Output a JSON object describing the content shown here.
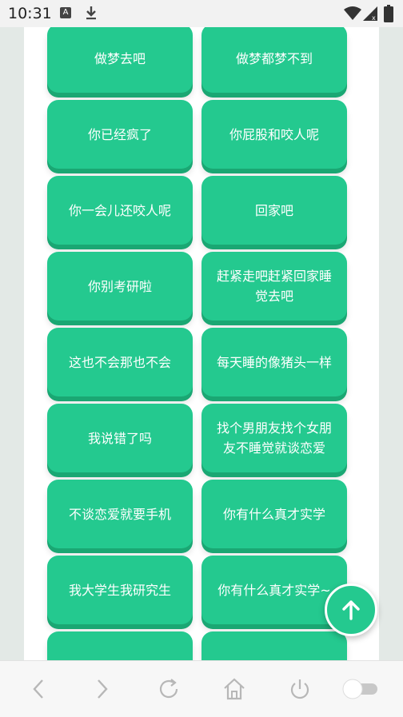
{
  "status_bar": {
    "time": "10:31",
    "icons": [
      "a-icon",
      "download-icon",
      "wifi-icon",
      "signal-icon",
      "battery-icon"
    ]
  },
  "buttons": [
    {
      "label": "做梦去吧"
    },
    {
      "label": "做梦都梦不到"
    },
    {
      "label": "你已经疯了"
    },
    {
      "label": "你屁股和咬人呢"
    },
    {
      "label": "你一会儿还咬人呢"
    },
    {
      "label": "回家吧"
    },
    {
      "label": "你别考研啦"
    },
    {
      "label": "赶紧走吧赶紧回家睡觉去吧"
    },
    {
      "label": "这也不会那也不会"
    },
    {
      "label": "每天睡的像猪头一样"
    },
    {
      "label": "我说错了吗"
    },
    {
      "label": "找个男朋友找个女朋友不睡觉就谈恋爱"
    },
    {
      "label": "不谈恋爱就要手机"
    },
    {
      "label": "你有什么真才实学"
    },
    {
      "label": "我大学生我研究生"
    },
    {
      "label": "你有什么真才实学~"
    },
    {
      "label": ""
    },
    {
      "label": ""
    }
  ],
  "colors": {
    "button": "#24c98f",
    "button_shadow": "#1aa773",
    "background": "#e3e9e6"
  },
  "fab": {
    "icon": "arrow-up-icon"
  },
  "nav_bar": {
    "items": [
      "back-icon",
      "forward-icon",
      "refresh-icon",
      "home-icon",
      "power-icon",
      "toggle-switch"
    ]
  }
}
